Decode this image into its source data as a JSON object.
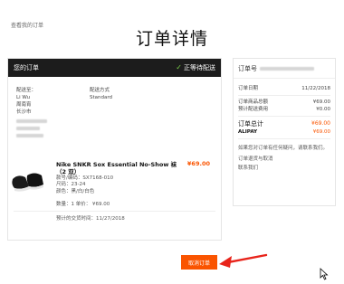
{
  "back_link": "查看我的订单",
  "page_title": "订单详情",
  "order": {
    "header_title": "您的订单",
    "status": "正等待配送",
    "address_label": "配送至：",
    "address_lines": [
      "Li Wu",
      "周南宵",
      "长沙市"
    ],
    "shipping_label": "配送方式",
    "shipping_method": "Standard"
  },
  "product": {
    "name": "Nike SNKR Sox Essential No-Show 袜（2 双）",
    "price": "¥69.00",
    "style": "款号/编码：SX7168-010",
    "size": "尺码：23-24",
    "color": "颜色：黑/白/白色",
    "qty": "数量：1  单价：  ¥69.00",
    "delivery": "预计的交货时间：11/27/2018"
  },
  "summary": {
    "title": "订单号",
    "rows": [
      {
        "label": "订单日期",
        "value": "11/22/2018"
      },
      {
        "label": "订单商品总额",
        "value": "¥69.00"
      },
      {
        "label": "预计配送费用",
        "value": "¥0.00"
      }
    ],
    "total_label": "订单总计",
    "total_value": "¥69.00",
    "payment_label": "ALIPAY",
    "payment_value": "¥69.00",
    "help_text": "如果您对订单有任何疑问，请联系我们。",
    "help_links": [
      "订单退货与取消",
      "联系我们"
    ]
  },
  "cancel_button": "取消订单",
  "colors": {
    "accent": "#fa5400",
    "arrow": "#e8241b",
    "header": "#1c1c1c"
  }
}
